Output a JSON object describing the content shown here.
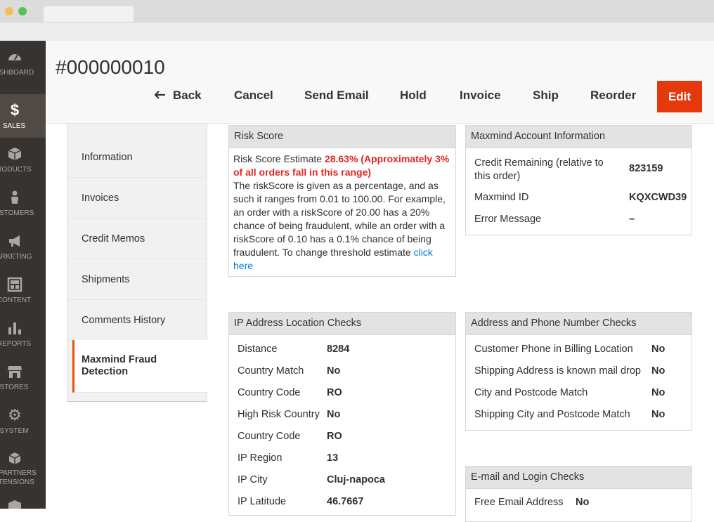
{
  "page_title": "#000000010",
  "actions": {
    "back": "Back",
    "cancel": "Cancel",
    "send_email": "Send Email",
    "hold": "Hold",
    "invoice": "Invoice",
    "ship": "Ship",
    "reorder": "Reorder",
    "edit": "Edit"
  },
  "sidebar": [
    {
      "label": "ASHBOARD",
      "icon": "dashboard-icon"
    },
    {
      "label": "SALES",
      "icon": "dollar-icon",
      "active": true
    },
    {
      "label": "RODUCTS",
      "icon": "box-icon"
    },
    {
      "label": "USTOMERS",
      "icon": "person-icon"
    },
    {
      "label": "ARKETING",
      "icon": "megaphone-icon"
    },
    {
      "label": "CONTENT",
      "icon": "layout-icon"
    },
    {
      "label": "REPORTS",
      "icon": "bar-chart-icon"
    },
    {
      "label": "STORES",
      "icon": "storefront-icon"
    },
    {
      "label": "SYSTEM",
      "icon": "gear-icon"
    },
    {
      "label": "D PARTNERS",
      "label2": "XTENSIONS",
      "icon": "blocks-icon"
    }
  ],
  "tabs": [
    "Information",
    "Invoices",
    "Credit Memos",
    "Shipments",
    "Comments History",
    "Maxmind Fraud Detection"
  ],
  "risk_score": {
    "heading": "Risk Score",
    "estimate_label": "Risk Score Estimate",
    "estimate_value": "28.63% (Approximately 3% of all orders fall in this range)",
    "description": "The riskScore is given as a percentage, and as such it ranges from 0.01 to 100.00. For example, an order with a riskScore of 20.00 has a 20% chance of being fraudulent, while an order with a riskScore of 0.10 has a 0.1% chance of being fraudulent. To change threshold estimate",
    "link": "click here"
  },
  "account_info": {
    "heading": "Maxmind Account Information",
    "rows": [
      {
        "label": "Credit Remaining (relative to this order)",
        "value": "823159"
      },
      {
        "label": "Maxmind ID",
        "value": "KQXCWD39"
      },
      {
        "label": "Error Message",
        "value": "–"
      }
    ]
  },
  "ip_checks": {
    "heading": "IP Address Location Checks",
    "rows": [
      {
        "label": "Distance",
        "value": "8284"
      },
      {
        "label": "Country Match",
        "value": "No"
      },
      {
        "label": "Country Code",
        "value": "RO"
      },
      {
        "label": "High Risk Country",
        "value": "No"
      },
      {
        "label": "Country Code",
        "value": "RO"
      },
      {
        "label": "IP Region",
        "value": "13"
      },
      {
        "label": "IP City",
        "value": "Cluj-napoca"
      },
      {
        "label": "IP Latitude",
        "value": "46.7667"
      }
    ]
  },
  "address_checks": {
    "heading": "Address and Phone Number Checks",
    "rows": [
      {
        "label": "Customer Phone in Billing Location",
        "value": "No"
      },
      {
        "label": "Shipping Address is known mail drop",
        "value": "No"
      },
      {
        "label": "City and Postcode Match",
        "value": "No"
      },
      {
        "label": "Shipping City and Postcode Match",
        "value": "No"
      }
    ]
  },
  "email_checks": {
    "heading": "E-mail and Login Checks",
    "rows": [
      {
        "label": "Free Email Address",
        "value": "No"
      }
    ]
  },
  "colors": {
    "accent": "#eb5202",
    "edit_button": "#e4380d",
    "sidebar": "#373330",
    "risk_red": "#e22626",
    "link": "#007bdb"
  }
}
